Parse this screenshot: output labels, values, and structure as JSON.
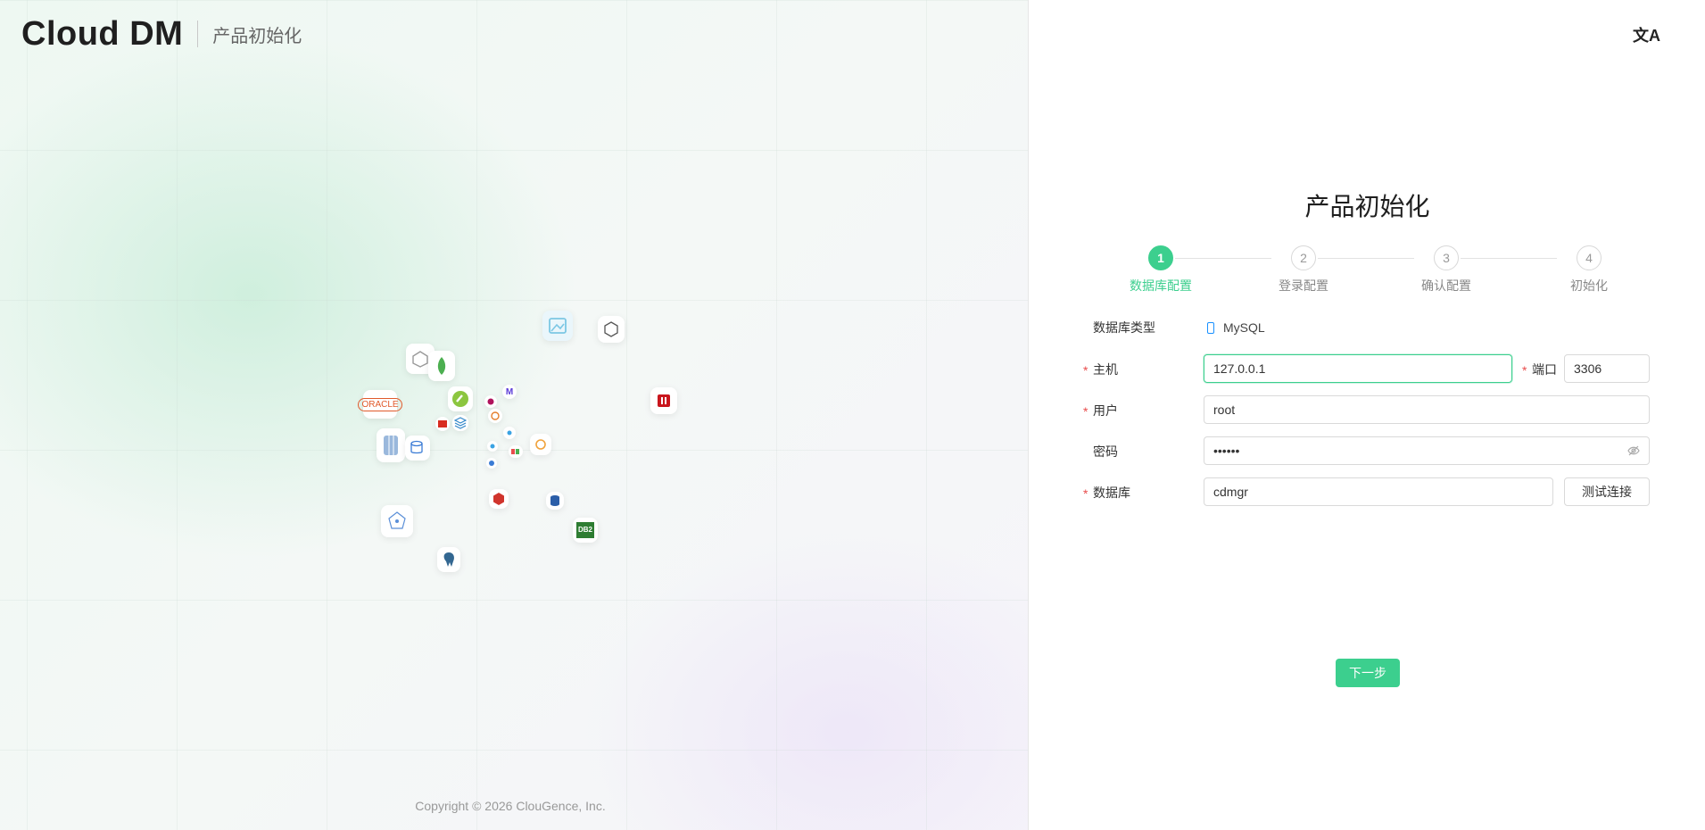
{
  "brand": {
    "logo_text": "Cloud DM",
    "subtitle": "产品初始化"
  },
  "copyright": "Copyright © 2026 ClouGence, Inc.",
  "lang_toggle": {
    "icon": "translate-icon",
    "label": "文A"
  },
  "page_title": "产品初始化",
  "steps": [
    {
      "number": "1",
      "label": "数据库配置",
      "active": true
    },
    {
      "number": "2",
      "label": "登录配置",
      "active": false
    },
    {
      "number": "3",
      "label": "确认配置",
      "active": false
    },
    {
      "number": "4",
      "label": "初始化",
      "active": false
    }
  ],
  "form": {
    "db_type_label": "数据库类型",
    "db_type_value": "MySQL",
    "host_label": "主机",
    "host_value": "127.0.0.1",
    "port_label": "端口",
    "port_value": "3306",
    "user_label": "用户",
    "user_value": "root",
    "password_label": "密码",
    "password_value": "••••••",
    "database_label": "数据库",
    "database_value": "cdmgr",
    "test_button": "测试连接",
    "required_mark": "*"
  },
  "next_button": "下一步",
  "db_logos": [
    "ORACLE",
    "DB2"
  ],
  "colors": {
    "accent": "#3ccf8e",
    "required": "#e84c4c",
    "link": "#1890ff"
  }
}
